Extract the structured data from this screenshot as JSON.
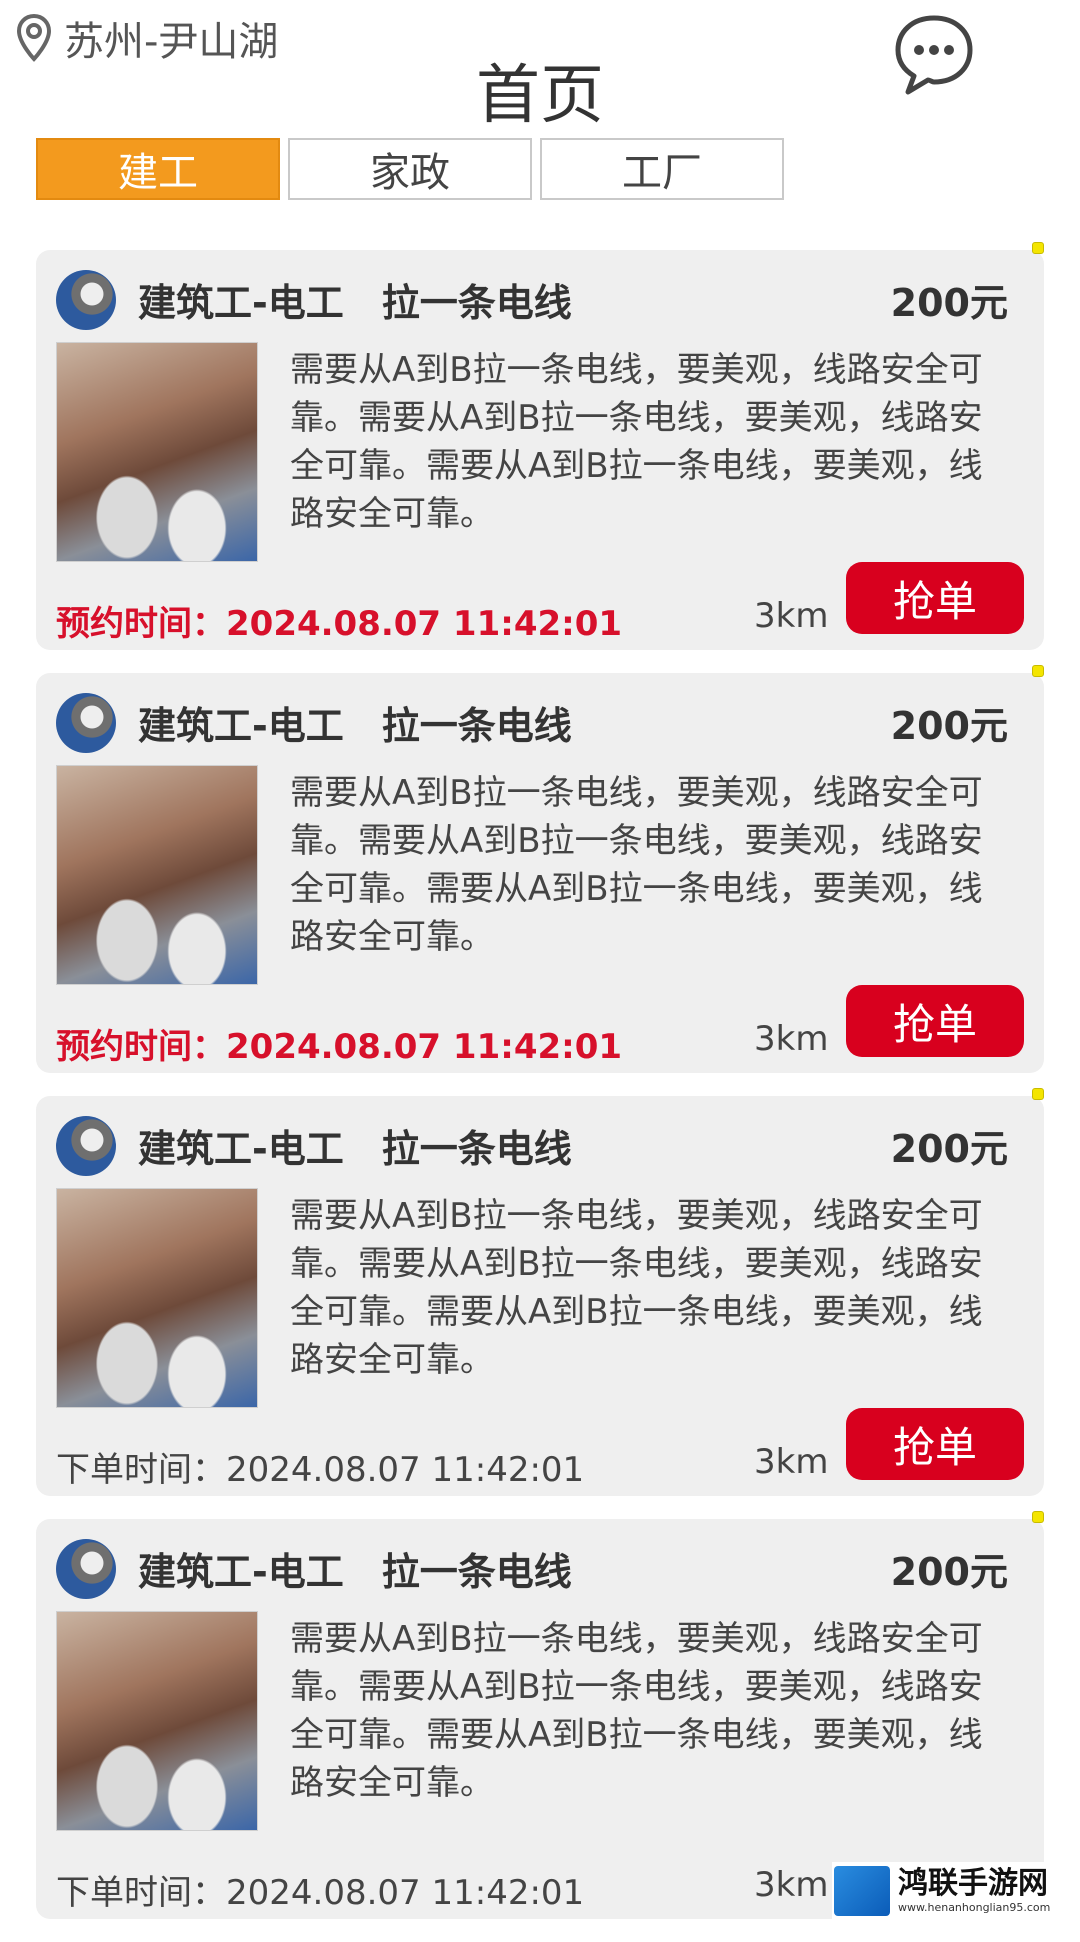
{
  "header": {
    "location": "苏州-尹山湖",
    "title": "首页",
    "location_icon": "location-pin-icon",
    "message_icon": "chat-bubble-icon"
  },
  "tabs": [
    {
      "label": "建工",
      "active": true
    },
    {
      "label": "家政",
      "active": false
    },
    {
      "label": "工厂",
      "active": false
    }
  ],
  "orders": [
    {
      "title": "建筑工-电工　拉一条电线",
      "price": "200元",
      "description": "需要从A到B拉一条电线，要美观，线路安全可靠。需要从A到B拉一条电线，要美观，线路安全可靠。需要从A到B拉一条电线，要美观，线路安全可靠。",
      "time": "预约时间：2024.08.07 11:42:01",
      "time_highlight": true,
      "distance": "3km",
      "button": "抢单"
    },
    {
      "title": "建筑工-电工　拉一条电线",
      "price": "200元",
      "description": "需要从A到B拉一条电线，要美观，线路安全可靠。需要从A到B拉一条电线，要美观，线路安全可靠。需要从A到B拉一条电线，要美观，线路安全可靠。",
      "time": "预约时间：2024.08.07 11:42:01",
      "time_highlight": true,
      "distance": "3km",
      "button": "抢单"
    },
    {
      "title": "建筑工-电工　拉一条电线",
      "price": "200元",
      "description": "需要从A到B拉一条电线，要美观，线路安全可靠。需要从A到B拉一条电线，要美观，线路安全可靠。需要从A到B拉一条电线，要美观，线路安全可靠。",
      "time": "下单时间：2024.08.07 11:42:01",
      "time_highlight": false,
      "distance": "3km",
      "button": "抢单"
    },
    {
      "title": "建筑工-电工　拉一条电线",
      "price": "200元",
      "description": "需要从A到B拉一条电线，要美观，线路安全可靠。需要从A到B拉一条电线，要美观，线路安全可靠。需要从A到B拉一条电线，要美观，线路安全可靠。",
      "time": "下单时间：2024.08.07 11:42:01",
      "time_highlight": false,
      "distance": "3km",
      "button": ""
    }
  ],
  "watermark": {
    "name": "鸿联手游网",
    "url": "www.henanhonglian95.com"
  },
  "colors": {
    "accent_tab": "#f39a1e",
    "button_red": "#d8001e",
    "time_red": "#d7102b",
    "card_bg": "#efefef"
  }
}
